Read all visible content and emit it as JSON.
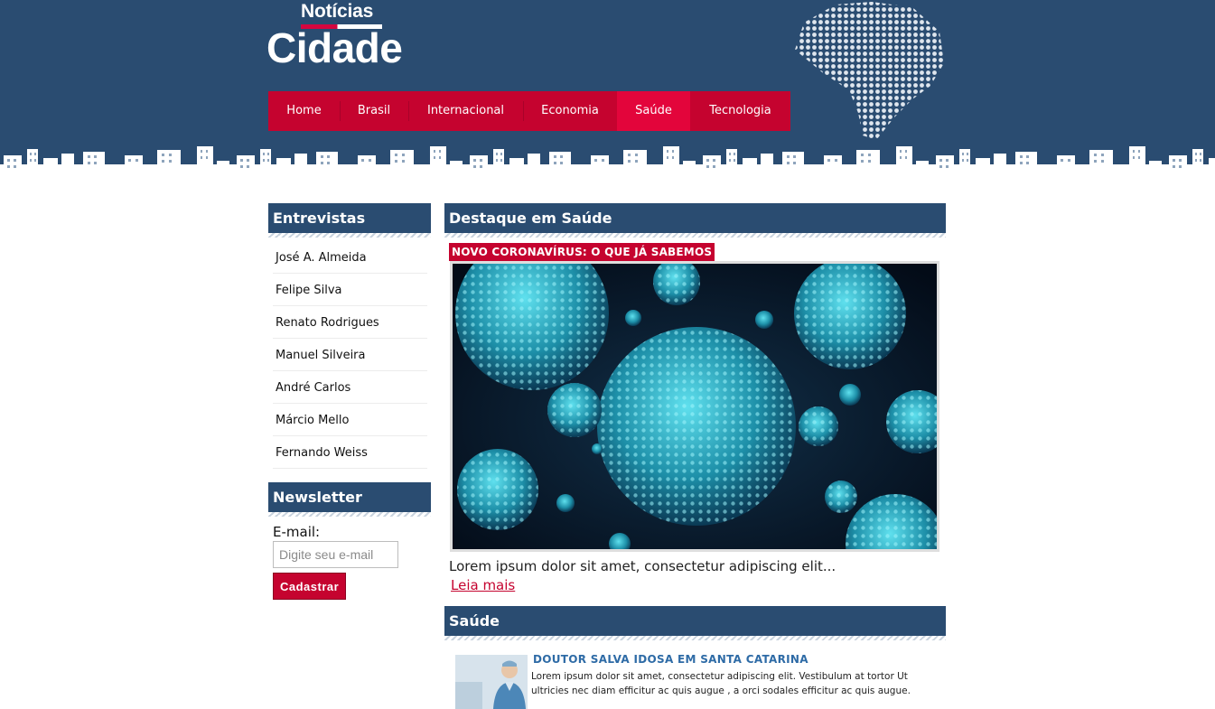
{
  "brand": {
    "logo_top": "Notícias",
    "logo_main": "Cidade",
    "accent_color": "#c5032f",
    "header_color": "#2a4c71"
  },
  "nav": {
    "items": [
      {
        "label": "Home"
      },
      {
        "label": "Brasil"
      },
      {
        "label": "Internacional"
      },
      {
        "label": "Economia"
      },
      {
        "label": "Saúde",
        "active": true
      },
      {
        "label": "Tecnologia"
      }
    ]
  },
  "sidebar": {
    "interviews": {
      "title": "Entrevistas",
      "items": [
        "José A. Almeida",
        "Felipe Silva",
        "Renato Rodrigues",
        "Manuel Silveira",
        "André Carlos",
        "Márcio Mello",
        "Fernando Weiss"
      ]
    },
    "newsletter": {
      "title": "Newsletter",
      "email_label": "E-mail:",
      "email_placeholder": "Digite seu e-mail",
      "email_value": "",
      "button_label": "Cadastrar"
    }
  },
  "main": {
    "feature": {
      "section_title": "Destaque em Saúde",
      "tag": "NOVO CORONAVÍRUS: O QUE JÁ SABEMOS",
      "image_icon": "virus-image",
      "excerpt": "Lorem ipsum dolor sit amet, consectetur adipiscing elit...",
      "read_more": "Leia mais"
    },
    "health": {
      "section_title": "Saúde",
      "news": [
        {
          "title": "DOUTOR SALVA IDOSA EM SANTA CATARINA",
          "summary": "Lorem ipsum dolor sit amet, consectetur adipiscing elit. Vestibulum at tortor Ut ultricies nec diam efficitur ac quis augue , a orci sodales efficitur ac quis augue."
        }
      ]
    }
  }
}
